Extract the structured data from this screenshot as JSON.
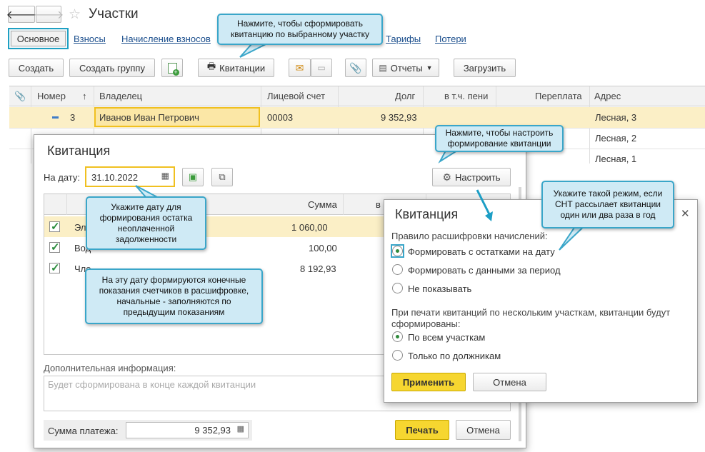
{
  "window": {
    "title": "Участки"
  },
  "tabs": [
    {
      "label": "Основное"
    },
    {
      "label": "Взносы"
    },
    {
      "label": "Начисление взносов"
    },
    {
      "label": "Тарифы"
    },
    {
      "label": "Потери"
    }
  ],
  "toolbar": {
    "create": "Создать",
    "create_group": "Создать группу",
    "receipts": "Квитанции",
    "reports": "Отчеты",
    "load": "Загрузить"
  },
  "table": {
    "headers": [
      "Номер",
      "Владелец",
      "Лицевой счет",
      "Долг",
      "в т.ч. пени",
      "Переплата",
      "Адрес"
    ],
    "rows": [
      {
        "number": "3",
        "owner": "Иванов Иван Петрович",
        "account": "00003",
        "debt": "9 352,93",
        "address": "Лесная, 3"
      },
      {
        "address": "Лесная, 2"
      },
      {
        "address": "Лесная, 1"
      }
    ]
  },
  "receipt_dialog": {
    "title": "Квитанция",
    "date_label": "На дату:",
    "date_value": "31.10.2022",
    "configure": "Настроить",
    "col_sum": "Сумма",
    "col_v": "в",
    "rows": [
      {
        "name": "Эл",
        "sum": "1 060,00"
      },
      {
        "name": "Вод",
        "sum": "100,00"
      },
      {
        "name": "Чле",
        "sum": "8 192,93"
      }
    ],
    "extra_label": "Дополнительная информация:",
    "extra_placeholder": "Будет сформирована в конце каждой квитанции",
    "payment_label": "Сумма платежа:",
    "payment_value": "9 352,93",
    "print": "Печать",
    "cancel": "Отмена"
  },
  "settings_dialog": {
    "title": "Квитанция",
    "rule_label": "Правило расшифровки начислений:",
    "options": [
      "Формировать с остатками на дату",
      "Формировать с данными за период",
      "Не показывать"
    ],
    "multi_label": "При печати квитанций по нескольким участкам, квитанции будут сформированы:",
    "multi_options": [
      "По всем участкам",
      "Только по должникам"
    ],
    "apply": "Применить",
    "cancel": "Отмена"
  },
  "callouts": {
    "receipt_hint": "Нажмите, чтобы сформировать квитанцию по выбранному участку",
    "configure_hint": "Нажмите, чтобы настроить формирование квитанции",
    "date_hint": "Укажите дату для формирования остатка неоплаченной задолженности",
    "meters_hint": "На эту дату формируются конечные показания счетчиков в расшифровке, начальные - заполняются по предыдущим показаниям",
    "mode_hint": "Укажите такой режим, если СНТ рассылает квитанции один или два раза в год"
  },
  "colors": {
    "accent_yellow": "#f6d630",
    "callout_border": "#3aa6c9",
    "selected_row": "#fbefc6"
  }
}
